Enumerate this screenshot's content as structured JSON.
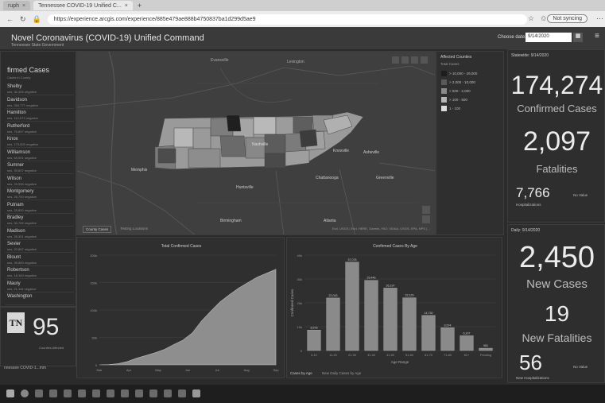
{
  "browser": {
    "tabs": [
      {
        "label": "ruph"
      },
      {
        "label": "Tennessee COVID-19 Unified C..."
      }
    ],
    "url": "https://experience.arcgis.com/experience/885e479ae888b4750837ba1d299d5ae9",
    "sync_label": "Not syncing"
  },
  "app": {
    "title": "Novel Coronavirus (COVID-19) Unified Command",
    "subtitle": "Tennessee State Government",
    "date_label": "Choose date:",
    "date_value": "9/14/2020"
  },
  "left_list": {
    "title": "firmed Cases",
    "subtitle": "Cases in County",
    "items": [
      {
        "name": "Shelby",
        "sub": "ses, 32,445 negative"
      },
      {
        "name": "Davidson",
        "sub": "ses, 264,777 negative"
      },
      {
        "name": "Hamilton",
        "sub": "ses, 112,073 negative"
      },
      {
        "name": "Rutherford",
        "sub": "ses, 76,897 negative"
      },
      {
        "name": "Knox",
        "sub": "ses, 173,820 negative"
      },
      {
        "name": "Williamson",
        "sub": "ses, 69,001 negative"
      },
      {
        "name": "Sumner",
        "sub": "ses, 39,607 negative"
      },
      {
        "name": "Wilson",
        "sub": "ses, 29,596 negative"
      },
      {
        "name": "Montgomery",
        "sub": "ses, 26,700 negative"
      },
      {
        "name": "Putnam",
        "sub": "ses, 25,800 negative"
      },
      {
        "name": "Bradley",
        "sub": "ses, 30,766 negative"
      },
      {
        "name": "Madison",
        "sub": "ses, 28,301 negative"
      },
      {
        "name": "Sevier",
        "sub": "ses, 20,867 negative"
      },
      {
        "name": "Blount",
        "sub": "ses, 35,883 negative"
      },
      {
        "name": "Robertson",
        "sub": "ses, 18,163 negative"
      },
      {
        "name": "Maury",
        "sub": "ses, 21,118 negative"
      },
      {
        "name": "Washington",
        "sub": ""
      }
    ]
  },
  "counties_box": {
    "logo": "TN",
    "count": "95",
    "label": "Counties Affected",
    "footer": "nnessee COVID-1...mm"
  },
  "map": {
    "tabs": [
      "County Cases",
      "Testing Locations"
    ],
    "attribution": "Esri, USGS | Esri, HERE, Garmin, FAO, NOAA, USGS, EPA, NPS | ...",
    "places": [
      {
        "name": "Evansville"
      },
      {
        "name": "Lexington"
      },
      {
        "name": "Knoxville"
      },
      {
        "name": "Nashville"
      },
      {
        "name": "Memphis"
      },
      {
        "name": "Chattanooga"
      },
      {
        "name": "Huntsville"
      },
      {
        "name": "Birmingham"
      },
      {
        "name": "Atlanta"
      },
      {
        "name": "Asheville"
      },
      {
        "name": "Greenville"
      }
    ],
    "legend": {
      "title": "Affected Counties",
      "subtitle": "Total Cases",
      "items": [
        {
          "label": "> 10,000 - 29,000",
          "color": "#1d1d1d"
        },
        {
          "label": "> 2,000 - 10,000",
          "color": "#5a5a5a"
        },
        {
          "label": "> 500 - 2,000",
          "color": "#8a8a8a"
        },
        {
          "label": "> 100 - 500",
          "color": "#b5b5b5"
        },
        {
          "label": "1 - 100",
          "color": "#dcdcdc"
        }
      ]
    }
  },
  "statewide": {
    "header": "Statewide: 9/14/2020",
    "confirmed": "174,274",
    "confirmed_label": "Confirmed Cases",
    "fatalities": "2,097",
    "fatalities_label": "Fatalities",
    "hospitalizations": "7,766",
    "hospitalizations_label": "Hospitalizations",
    "no_value": "No Value"
  },
  "daily": {
    "header": "Daily: 9/14/2020",
    "new_cases": "2,450",
    "new_cases_label": "New Cases",
    "new_fatalities": "19",
    "new_fatalities_label": "New Fatalities",
    "new_hosp": "56",
    "new_hosp_label": "New Hospitalizations",
    "no_value": "No Value"
  },
  "chart_data": [
    {
      "type": "area",
      "title": "Total Confirmed Cases",
      "x_labels": [
        "Mar",
        "Apr",
        "May",
        "Jun",
        "Jul",
        "Aug",
        "Sep"
      ],
      "y_ticks": [
        "200k",
        "150k",
        "100k",
        "50k",
        "0"
      ],
      "ylim": [
        0,
        200000
      ],
      "values": [
        0,
        500,
        2000,
        6000,
        12000,
        17000,
        22000,
        28000,
        37000,
        45000,
        58000,
        80000,
        98000,
        115000,
        128000,
        140000,
        150000,
        160000,
        167000,
        174274
      ]
    },
    {
      "type": "bar",
      "title": "Confirmed Cases By Age",
      "xlabel": "Age Range",
      "ylabel": "Confirmed Cases",
      "categories": [
        "0-10",
        "11-20",
        "21-30",
        "31-40",
        "41-50",
        "51-60",
        "61-70",
        "71-80",
        "81+",
        "Pending"
      ],
      "values": [
        8578,
        22043,
        37078,
        29446,
        26197,
        22129,
        14730,
        9574,
        6207,
        981
      ],
      "value_labels": [
        "8,578",
        "22,043",
        "37,078",
        "29,446",
        "26,197",
        "22,129",
        "14,730",
        "9,574",
        "6,207",
        "981"
      ],
      "y_ticks": [
        "40k",
        "30k",
        "20k",
        "10k",
        "0"
      ],
      "ylim": [
        0,
        40000
      ],
      "tabs": [
        "Cases by Age",
        "New Daily Cases by Age"
      ]
    }
  ]
}
